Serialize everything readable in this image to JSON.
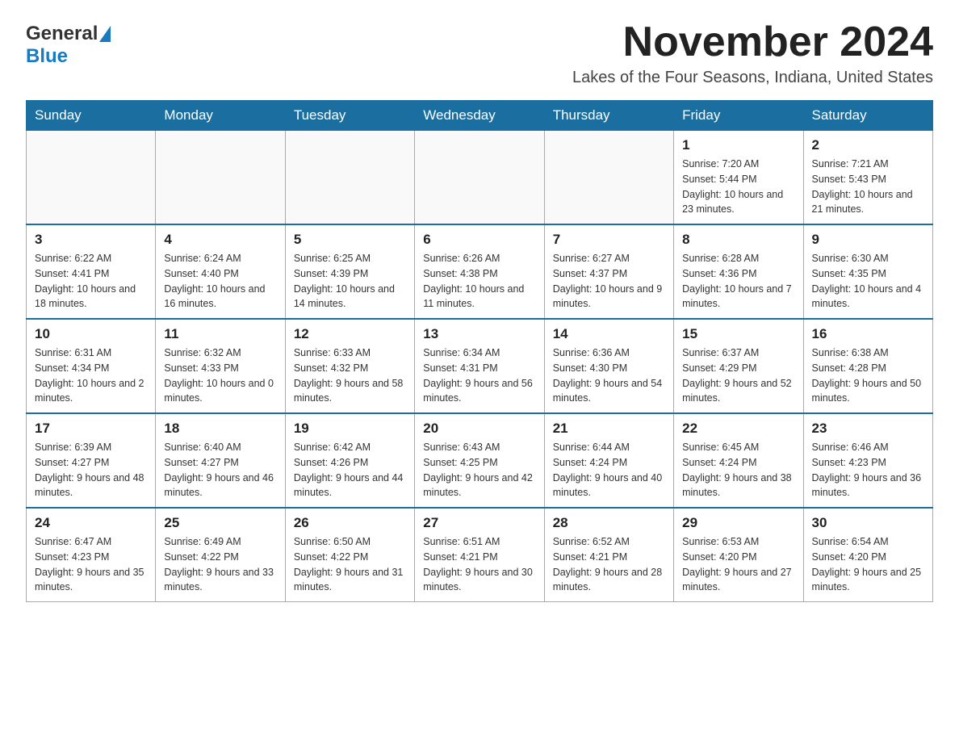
{
  "logo": {
    "general_text": "General",
    "blue_text": "Blue"
  },
  "header": {
    "month_title": "November 2024",
    "location": "Lakes of the Four Seasons, Indiana, United States"
  },
  "weekdays": [
    "Sunday",
    "Monday",
    "Tuesday",
    "Wednesday",
    "Thursday",
    "Friday",
    "Saturday"
  ],
  "weeks": [
    [
      {
        "day": "",
        "info": ""
      },
      {
        "day": "",
        "info": ""
      },
      {
        "day": "",
        "info": ""
      },
      {
        "day": "",
        "info": ""
      },
      {
        "day": "",
        "info": ""
      },
      {
        "day": "1",
        "info": "Sunrise: 7:20 AM\nSunset: 5:44 PM\nDaylight: 10 hours and 23 minutes."
      },
      {
        "day": "2",
        "info": "Sunrise: 7:21 AM\nSunset: 5:43 PM\nDaylight: 10 hours and 21 minutes."
      }
    ],
    [
      {
        "day": "3",
        "info": "Sunrise: 6:22 AM\nSunset: 4:41 PM\nDaylight: 10 hours and 18 minutes."
      },
      {
        "day": "4",
        "info": "Sunrise: 6:24 AM\nSunset: 4:40 PM\nDaylight: 10 hours and 16 minutes."
      },
      {
        "day": "5",
        "info": "Sunrise: 6:25 AM\nSunset: 4:39 PM\nDaylight: 10 hours and 14 minutes."
      },
      {
        "day": "6",
        "info": "Sunrise: 6:26 AM\nSunset: 4:38 PM\nDaylight: 10 hours and 11 minutes."
      },
      {
        "day": "7",
        "info": "Sunrise: 6:27 AM\nSunset: 4:37 PM\nDaylight: 10 hours and 9 minutes."
      },
      {
        "day": "8",
        "info": "Sunrise: 6:28 AM\nSunset: 4:36 PM\nDaylight: 10 hours and 7 minutes."
      },
      {
        "day": "9",
        "info": "Sunrise: 6:30 AM\nSunset: 4:35 PM\nDaylight: 10 hours and 4 minutes."
      }
    ],
    [
      {
        "day": "10",
        "info": "Sunrise: 6:31 AM\nSunset: 4:34 PM\nDaylight: 10 hours and 2 minutes."
      },
      {
        "day": "11",
        "info": "Sunrise: 6:32 AM\nSunset: 4:33 PM\nDaylight: 10 hours and 0 minutes."
      },
      {
        "day": "12",
        "info": "Sunrise: 6:33 AM\nSunset: 4:32 PM\nDaylight: 9 hours and 58 minutes."
      },
      {
        "day": "13",
        "info": "Sunrise: 6:34 AM\nSunset: 4:31 PM\nDaylight: 9 hours and 56 minutes."
      },
      {
        "day": "14",
        "info": "Sunrise: 6:36 AM\nSunset: 4:30 PM\nDaylight: 9 hours and 54 minutes."
      },
      {
        "day": "15",
        "info": "Sunrise: 6:37 AM\nSunset: 4:29 PM\nDaylight: 9 hours and 52 minutes."
      },
      {
        "day": "16",
        "info": "Sunrise: 6:38 AM\nSunset: 4:28 PM\nDaylight: 9 hours and 50 minutes."
      }
    ],
    [
      {
        "day": "17",
        "info": "Sunrise: 6:39 AM\nSunset: 4:27 PM\nDaylight: 9 hours and 48 minutes."
      },
      {
        "day": "18",
        "info": "Sunrise: 6:40 AM\nSunset: 4:27 PM\nDaylight: 9 hours and 46 minutes."
      },
      {
        "day": "19",
        "info": "Sunrise: 6:42 AM\nSunset: 4:26 PM\nDaylight: 9 hours and 44 minutes."
      },
      {
        "day": "20",
        "info": "Sunrise: 6:43 AM\nSunset: 4:25 PM\nDaylight: 9 hours and 42 minutes."
      },
      {
        "day": "21",
        "info": "Sunrise: 6:44 AM\nSunset: 4:24 PM\nDaylight: 9 hours and 40 minutes."
      },
      {
        "day": "22",
        "info": "Sunrise: 6:45 AM\nSunset: 4:24 PM\nDaylight: 9 hours and 38 minutes."
      },
      {
        "day": "23",
        "info": "Sunrise: 6:46 AM\nSunset: 4:23 PM\nDaylight: 9 hours and 36 minutes."
      }
    ],
    [
      {
        "day": "24",
        "info": "Sunrise: 6:47 AM\nSunset: 4:23 PM\nDaylight: 9 hours and 35 minutes."
      },
      {
        "day": "25",
        "info": "Sunrise: 6:49 AM\nSunset: 4:22 PM\nDaylight: 9 hours and 33 minutes."
      },
      {
        "day": "26",
        "info": "Sunrise: 6:50 AM\nSunset: 4:22 PM\nDaylight: 9 hours and 31 minutes."
      },
      {
        "day": "27",
        "info": "Sunrise: 6:51 AM\nSunset: 4:21 PM\nDaylight: 9 hours and 30 minutes."
      },
      {
        "day": "28",
        "info": "Sunrise: 6:52 AM\nSunset: 4:21 PM\nDaylight: 9 hours and 28 minutes."
      },
      {
        "day": "29",
        "info": "Sunrise: 6:53 AM\nSunset: 4:20 PM\nDaylight: 9 hours and 27 minutes."
      },
      {
        "day": "30",
        "info": "Sunrise: 6:54 AM\nSunset: 4:20 PM\nDaylight: 9 hours and 25 minutes."
      }
    ]
  ]
}
